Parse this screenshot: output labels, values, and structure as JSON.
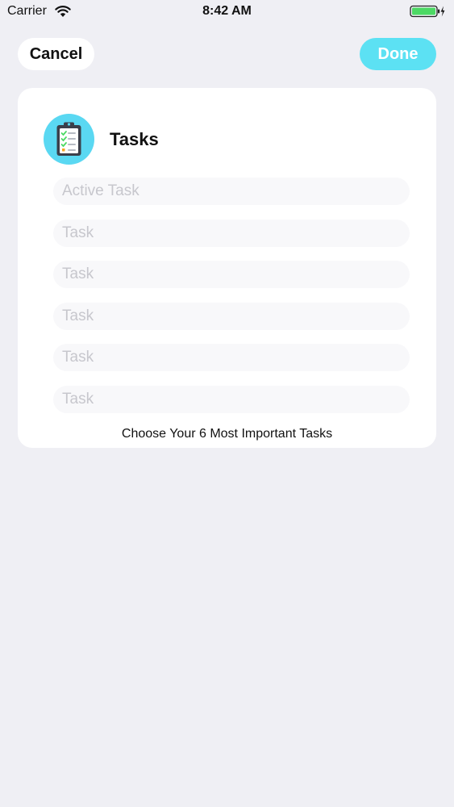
{
  "status_bar": {
    "carrier": "Carrier",
    "time": "8:42 AM",
    "icons": [
      "wifi-icon",
      "battery-icon",
      "charging-bolt-icon"
    ]
  },
  "nav": {
    "cancel_label": "Cancel",
    "done_label": "Done"
  },
  "card": {
    "icon": "clipboard-checklist-icon",
    "title": "Tasks",
    "tasks": [
      {
        "value": "",
        "placeholder": "Active Task"
      },
      {
        "value": "",
        "placeholder": "Task"
      },
      {
        "value": "",
        "placeholder": "Task"
      },
      {
        "value": "",
        "placeholder": "Task"
      },
      {
        "value": "",
        "placeholder": "Task"
      },
      {
        "value": "",
        "placeholder": "Task"
      }
    ],
    "footer": "Choose Your 6 Most Important Tasks"
  },
  "colors": {
    "background": "#efeff4",
    "accent": "#5ce1f3",
    "icon_circle": "#5ad8f2",
    "battery": "#4cd964"
  }
}
